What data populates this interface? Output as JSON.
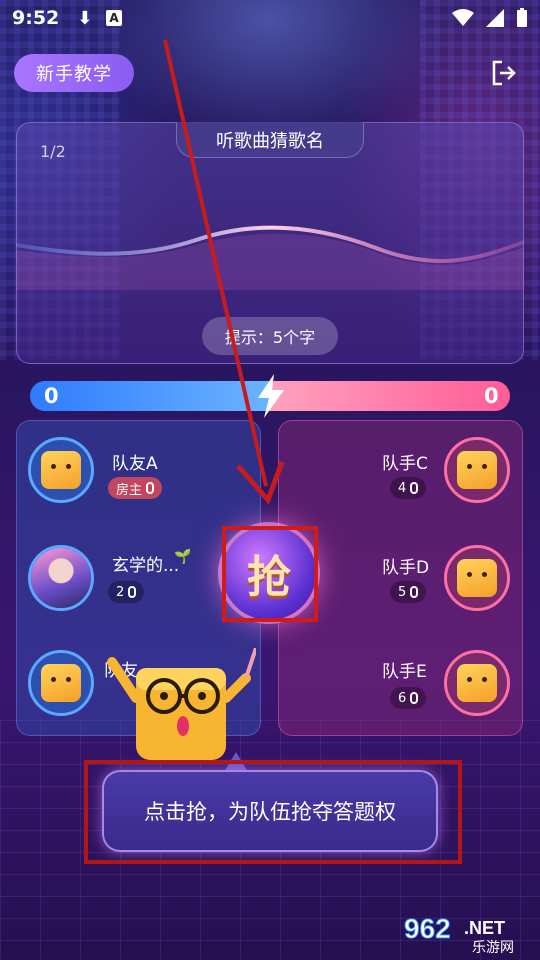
{
  "status_bar": {
    "time": "9:52"
  },
  "toolbar": {
    "tutorial_label": "新手教学"
  },
  "song_card": {
    "title": "听歌曲猜歌名",
    "progress": "1/2",
    "hint": "提示：5个字"
  },
  "scores": {
    "team_a": "0",
    "team_b": "0"
  },
  "grab_button": {
    "label": "抢"
  },
  "team_left": {
    "players": [
      {
        "name": "队友A",
        "badge": "房主"
      },
      {
        "name": "玄学的...",
        "badge": "2"
      },
      {
        "name": "队友"
      }
    ]
  },
  "team_right": {
    "players": [
      {
        "name": "队手C",
        "badge": "4"
      },
      {
        "name": "队手D",
        "badge": "5"
      },
      {
        "name": "队手E",
        "badge": "6"
      }
    ]
  },
  "tooltip": {
    "text": "点击抢，为队伍抢夺答题权"
  },
  "watermark": {
    "brand": "962.NET",
    "site": "乐游网"
  },
  "colors": {
    "team_a": "#2f7bff",
    "team_b": "#ff5c95",
    "annotation": "#d11b1b"
  }
}
